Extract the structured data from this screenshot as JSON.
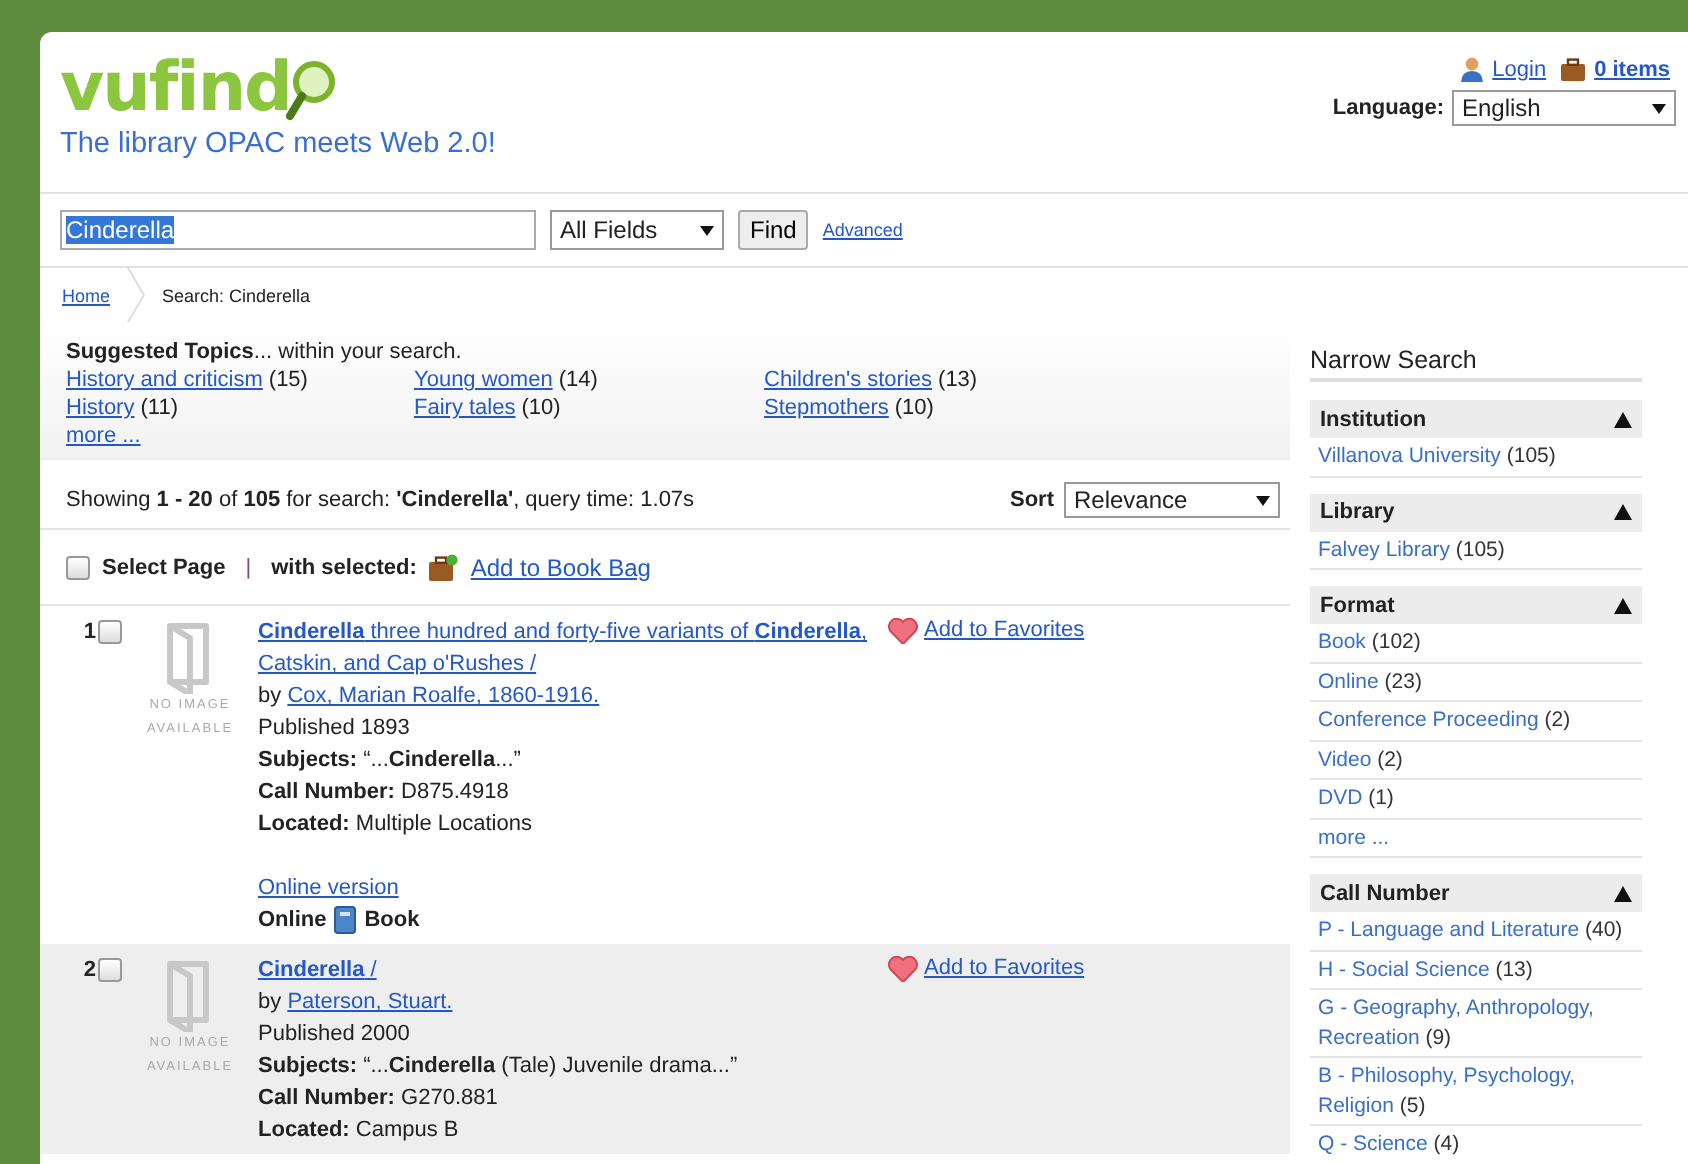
{
  "header": {
    "logo": "vufind",
    "tagline": "The library OPAC meets Web 2.0!",
    "login": "Login",
    "bag": "0 items",
    "language_label": "Language:",
    "language": "English"
  },
  "search": {
    "value": "Cinderella",
    "field": "All Fields",
    "button": "Find",
    "advanced": "Advanced"
  },
  "breadcrumb": [
    "Home",
    "Search: Cinderella"
  ],
  "suggested": {
    "heading": "**Suggested Topics**... within your search.",
    "topics": [
      {
        "label": "History and criticism",
        "count": "(15)"
      },
      {
        "label": "Young women",
        "count": "(14)"
      },
      {
        "label": "Children's stories",
        "count": "(13)"
      },
      {
        "label": "History",
        "count": "(11)"
      },
      {
        "label": "Fairy tales",
        "count": "(10)"
      },
      {
        "label": "Stepmothers",
        "count": "(10)"
      }
    ],
    "more": "more ..."
  },
  "summary": "Showing **1 - 20** of **105** for search: **'Cinderella'**, query time: 1.07s",
  "sort": {
    "label": "Sort",
    "value": "Relevance"
  },
  "bulk": {
    "checked": false,
    "select_page": "Select Page",
    "separator": "|",
    "with_selected": "with selected:",
    "action": "Add to Book Bag"
  },
  "results": [
    {
      "number": "1",
      "checked": false,
      "cover_text": "NO IMAGE AVAILABLE",
      "title": "**Cinderella** three hundred and forty-five variants of **Cinderella**, Catskin, and Cap o'Rushes /",
      "by": "by",
      "author": "Cox, Marian Roalfe, 1860-1916.",
      "published": "Published 1893",
      "subjects_label": "Subjects:",
      "subjects": "“...**Cinderella**...”",
      "call_label": "Call Number:",
      "call": "D875.4918",
      "located_label": "Located:",
      "located": "Multiple Locations",
      "online_link": "Online version",
      "formats": [
        "Online",
        "Book"
      ],
      "favorite": "Add to Favorites",
      "shaded": false
    },
    {
      "number": "2",
      "checked": false,
      "cover_text": "NO IMAGE AVAILABLE",
      "title": "**Cinderella** /",
      "by": "by",
      "author": "Paterson, Stuart.",
      "published": "Published 2000",
      "subjects_label": "Subjects:",
      "subjects": "“...**Cinderella** (Tale) Juvenile drama...”",
      "call_label": "Call Number:",
      "call": "G270.881",
      "located_label": "Located:",
      "located": "Campus B",
      "favorite": "Add to Favorites",
      "shaded": true
    }
  ],
  "sidebar": {
    "title": "Narrow Search",
    "facets": [
      {
        "title": "Institution",
        "expanded": true,
        "items": [
          {
            "kind": "value",
            "label": "Villanova University",
            "count": "(105)"
          }
        ]
      },
      {
        "title": "Library",
        "expanded": true,
        "items": [
          {
            "kind": "value",
            "label": "Falvey Library",
            "count": "(105)"
          }
        ]
      },
      {
        "title": "Format",
        "expanded": true,
        "items": [
          {
            "kind": "value",
            "label": "Book",
            "count": "(102)"
          },
          {
            "kind": "value",
            "label": "Online",
            "count": "(23)"
          },
          {
            "kind": "value",
            "label": "Conference Proceeding",
            "count": "(2)"
          },
          {
            "kind": "value",
            "label": "Video",
            "count": "(2)"
          },
          {
            "kind": "value",
            "label": "DVD",
            "count": "(1)"
          },
          {
            "kind": "more",
            "label": "more ..."
          }
        ]
      },
      {
        "title": "Call Number",
        "expanded": true,
        "items": [
          {
            "kind": "value",
            "label": "P - Language and Literature",
            "count": "(40)"
          },
          {
            "kind": "value",
            "label": "H - Social Science",
            "count": "(13)"
          },
          {
            "kind": "value",
            "label": "G - Geography, Anthropology, Recreation",
            "count": "(9)"
          },
          {
            "kind": "value",
            "label": "B - Philosophy, Psychology, Religion",
            "count": "(5)"
          },
          {
            "kind": "value",
            "label": "Q - Science",
            "count": "(4)"
          }
        ]
      }
    ]
  }
}
